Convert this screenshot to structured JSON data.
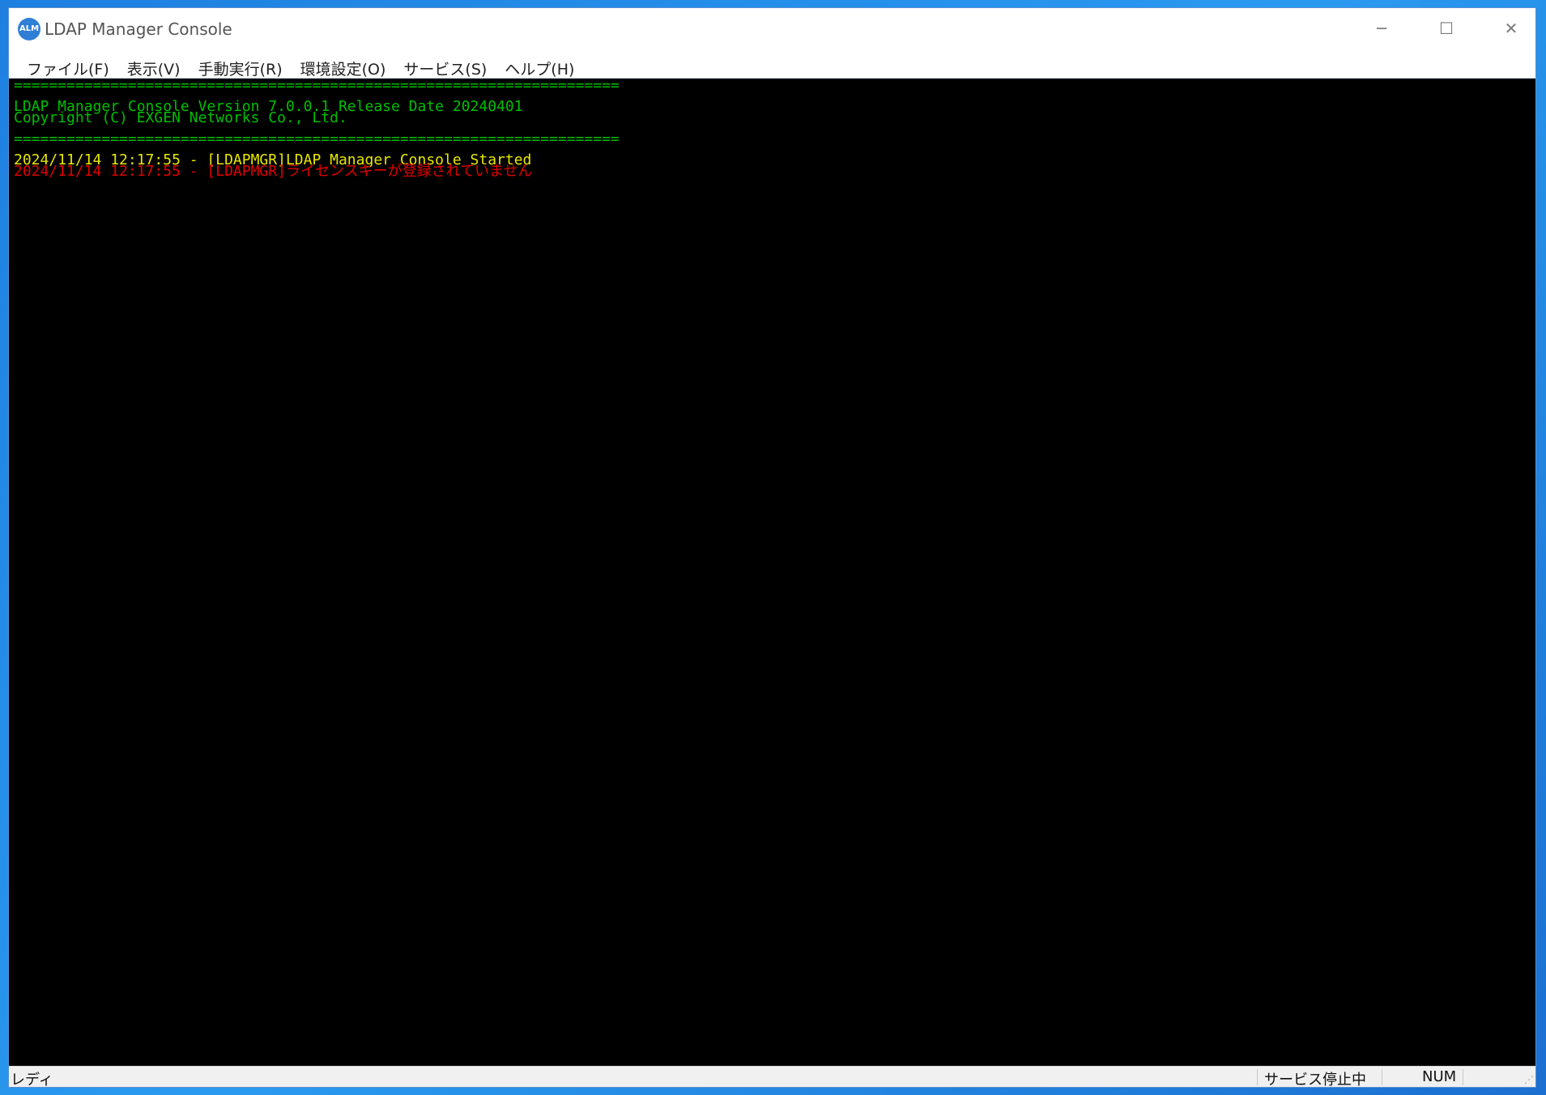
{
  "window": {
    "title": "LDAP Manager Console",
    "icon_label": "ALM",
    "controls": {
      "minimize": "─",
      "maximize": "☐",
      "close": "✕"
    }
  },
  "menu": {
    "items": [
      {
        "label": "ファイル(F)"
      },
      {
        "label": "表示(V)"
      },
      {
        "label": "手動実行(R)"
      },
      {
        "label": "環境設定(O)"
      },
      {
        "label": "サービス(S)"
      },
      {
        "label": "ヘルプ(H)"
      }
    ]
  },
  "console": {
    "background": "#000000",
    "lines": [
      {
        "text": "=====================================================================",
        "color": "#00c000"
      },
      {
        "text": "LDAP Manager Console Version 7.0.0.1 Release Date 20240401",
        "color": "#00c000"
      },
      {
        "text": "Copyright (C) EXGEN Networks Co., Ltd.",
        "color": "#00c000"
      },
      {
        "text": "=====================================================================",
        "color": "#00c000"
      },
      {
        "text": "2024/11/14 12:17:55 - [LDAPMGR]LDAP Manager Console Started",
        "color": "#e8e800"
      },
      {
        "text": "2024/11/14 12:17:55 - [LDAPMGR]ライセンスキーが登録されていません",
        "color": "#e00000"
      }
    ]
  },
  "statusbar": {
    "ready": "レディ",
    "service_status": "サービス停止中",
    "num": "NUM"
  }
}
